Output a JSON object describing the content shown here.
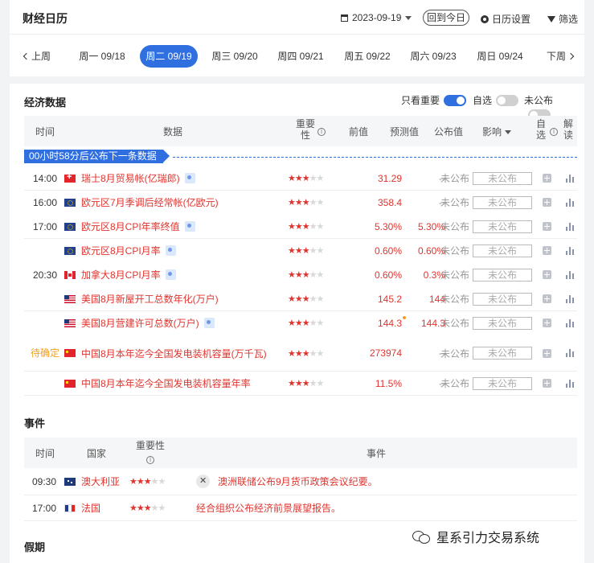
{
  "header": {
    "title": "财经日历",
    "date": "2023-09-19",
    "today_button": "回到今日",
    "settings_label": "日历设置",
    "filter_label": "筛选"
  },
  "week": {
    "prev": "上周",
    "next": "下周",
    "days": [
      {
        "label": "周一 09/18",
        "active": false
      },
      {
        "label": "周二 09/19",
        "active": true
      },
      {
        "label": "周三 09/20",
        "active": false
      },
      {
        "label": "周四 09/21",
        "active": false
      },
      {
        "label": "周五 09/22",
        "active": false
      },
      {
        "label": "周六 09/23",
        "active": false
      },
      {
        "label": "周日 09/24",
        "active": false
      }
    ]
  },
  "economic": {
    "title": "经济数据",
    "toggles": {
      "important_only": {
        "label": "只看重要",
        "on": true
      },
      "watchlist": {
        "label": "自选",
        "on": false
      },
      "unpublished": {
        "label": "未公布",
        "on": false
      }
    },
    "columns": {
      "time": "时间",
      "data": "数据",
      "importance": "重要性",
      "previous": "前值",
      "forecast": "预测值",
      "actual": "公布值",
      "impact": "影响",
      "watch": "自选",
      "explain": "解读"
    },
    "countdown": "00小时58分后公布下一条数据",
    "rows": [
      {
        "time": "14:00",
        "flag": "ch",
        "name": "瑞士8月贸易帐(亿瑞郎)",
        "tag": true,
        "stars": 3,
        "previous": "31.29",
        "forecast": "--",
        "actual": "未公布",
        "impact": "未公布"
      },
      {
        "time": "16:00",
        "flag": "eu",
        "name": "欧元区7月季调后经常帐(亿欧元)",
        "tag": false,
        "stars": 3,
        "previous": "358.4",
        "forecast": "--",
        "actual": "未公布",
        "impact": "未公布"
      },
      {
        "time": "17:00",
        "flag": "eu",
        "name": "欧元区8月CPI年率终值",
        "tag": true,
        "stars": 3,
        "previous": "5.30%",
        "forecast": "5.30%",
        "actual": "未公布",
        "impact": "未公布"
      },
      {
        "time": "",
        "flag": "eu",
        "name": "欧元区8月CPI月率",
        "tag": true,
        "stars": 3,
        "previous": "0.60%",
        "forecast": "0.60%",
        "actual": "未公布",
        "impact": "未公布"
      },
      {
        "time": "20:30",
        "flag": "ca",
        "name": "加拿大8月CPI月率",
        "tag": true,
        "stars": 3,
        "previous": "0.60%",
        "forecast": "0.3%",
        "actual": "未公布",
        "impact": "未公布"
      },
      {
        "time": "",
        "flag": "us",
        "name": "美国8月新屋开工总数年化(万户)",
        "tag": false,
        "stars": 3,
        "previous": "145.2",
        "forecast": "144",
        "actual": "未公布",
        "impact": "未公布"
      },
      {
        "time": "",
        "flag": "us",
        "name": "美国8月营建许可总数(万户)",
        "tag": true,
        "stars": 3,
        "previous": "144.3",
        "forecast": "144.3",
        "actual": "未公布",
        "impact": "未公布",
        "revised": true
      },
      {
        "time": "待确定",
        "flag": "cn",
        "name": "中国8月本年迄今全国发电装机容量(万千瓦)",
        "tag": false,
        "stars": 3,
        "previous": "273974",
        "forecast": "--",
        "actual": "未公布",
        "impact": "未公布"
      },
      {
        "time": "",
        "flag": "cn",
        "name": "中国8月本年迄今全国发电装机容量年率",
        "tag": false,
        "stars": 3,
        "previous": "11.5%",
        "forecast": "--",
        "actual": "未公布",
        "impact": "未公布"
      }
    ]
  },
  "events": {
    "title": "事件",
    "columns": {
      "time": "时间",
      "country": "国家",
      "importance": "重要性",
      "event": "事件"
    },
    "rows": [
      {
        "time": "09:30",
        "flag": "au",
        "country": "澳大利亚",
        "stars": 3,
        "logo": true,
        "text": "澳洲联储公布9月货币政策会议纪要。"
      },
      {
        "time": "17:00",
        "flag": "fr",
        "country": "法国",
        "stars": 3,
        "logo": false,
        "text": "经合组织公布经济前景展望报告。"
      }
    ]
  },
  "holidays": {
    "title": "假期"
  },
  "watermark": "星系引力交易系统",
  "colors": {
    "accent": "#2f6fe0",
    "up": "#e0342f",
    "pending": "#f0a020"
  }
}
